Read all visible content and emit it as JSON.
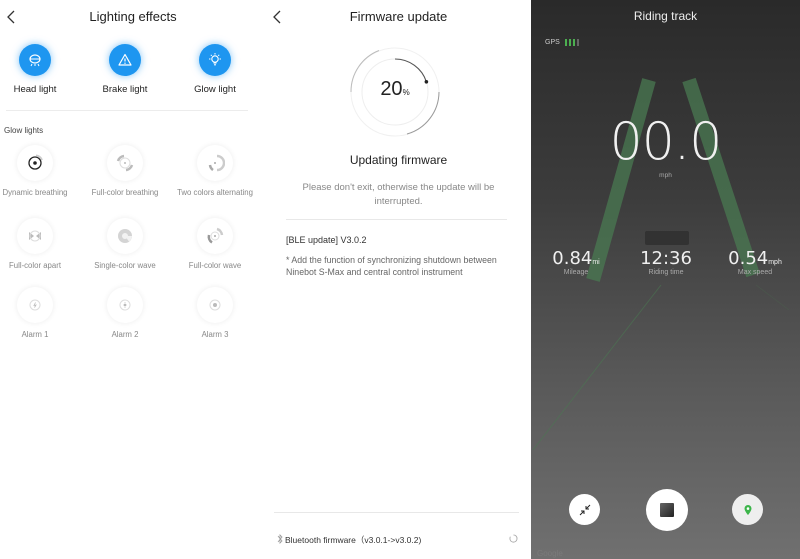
{
  "lighting": {
    "title": "Lighting effects",
    "back_icon": "chevron-left-icon",
    "main_lights": [
      {
        "label": "Head light",
        "icon": "headlight-icon"
      },
      {
        "label": "Brake light",
        "icon": "warning-triangle-icon"
      },
      {
        "label": "Glow light",
        "icon": "lightbulb-icon"
      }
    ],
    "accent_color": "#1e96f0",
    "section_label": "Glow lights",
    "glow_effects": [
      {
        "label": "Dynamic breathing",
        "icon": "dynamic-breathing-icon"
      },
      {
        "label": "Full-color breathing",
        "icon": "full-color-breathing-icon"
      },
      {
        "label": "Two colors alternating",
        "icon": "two-colors-alternating-icon"
      },
      {
        "label": "Full-color apart",
        "icon": "full-color-apart-icon"
      },
      {
        "label": "Single-color wave",
        "icon": "single-color-wave-icon"
      },
      {
        "label": "Full-color wave",
        "icon": "full-color-wave-icon"
      },
      {
        "label": "Alarm 1",
        "icon": "alarm-1-icon"
      },
      {
        "label": "Alarm 2",
        "icon": "alarm-2-icon"
      },
      {
        "label": "Alarm 3",
        "icon": "alarm-3-icon"
      }
    ]
  },
  "firmware": {
    "title": "Firmware update",
    "back_icon": "chevron-left-icon",
    "progress_percent": 20,
    "progress_value": "20",
    "progress_unit": "%",
    "status_title": "Updating firmware",
    "status_message": "Please don't exit, otherwise the update will be interrupted.",
    "version_line": "[BLE update] V3.0.2",
    "release_notes": "* Add the function of synchronizing shutdown between Ninebot S-Max and central control instrument",
    "component": {
      "icon": "bluetooth-icon",
      "label": "Bluetooth firmware（v3.0.1->v3.0.2)",
      "status_icon": "loading-spinner-icon"
    }
  },
  "riding": {
    "title": "Riding track",
    "gps_label": "GPS",
    "gps_bars_active": 3,
    "gps_bars_total": 4,
    "speed": "00.0",
    "speed_unit": "mph",
    "stats": [
      {
        "value": "0.84",
        "unit": "mi",
        "label": "Mileage"
      },
      {
        "value": "12:36",
        "unit": "",
        "label": "Riding time"
      },
      {
        "value": "0.54",
        "unit": "mph",
        "label": "Max speed"
      }
    ],
    "track_color": "#4a7a52",
    "controls": [
      {
        "name": "collapse",
        "icon": "collapse-arrows-icon"
      },
      {
        "name": "stop",
        "icon": "stop-icon"
      },
      {
        "name": "map",
        "icon": "map-pin-icon"
      }
    ],
    "map_attribution": "Google"
  }
}
